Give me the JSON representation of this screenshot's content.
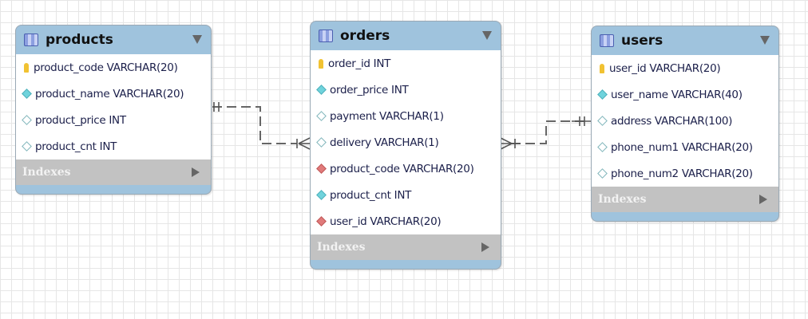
{
  "tables": [
    {
      "id": "products",
      "name": "products",
      "indexes_label": "Indexes",
      "columns": [
        {
          "text": "product_code VARCHAR(20)",
          "kind": "pk"
        },
        {
          "text": "product_name VARCHAR(20)",
          "kind": "nn"
        },
        {
          "text": "product_price INT",
          "kind": "null"
        },
        {
          "text": "product_cnt INT",
          "kind": "null"
        }
      ]
    },
    {
      "id": "orders",
      "name": "orders",
      "indexes_label": "Indexes",
      "columns": [
        {
          "text": "order_id INT",
          "kind": "pk"
        },
        {
          "text": "order_price INT",
          "kind": "nn"
        },
        {
          "text": "payment VARCHAR(1)",
          "kind": "null"
        },
        {
          "text": "delivery VARCHAR(1)",
          "kind": "null"
        },
        {
          "text": "product_code VARCHAR(20)",
          "kind": "fk"
        },
        {
          "text": "product_cnt INT",
          "kind": "nn"
        },
        {
          "text": "user_id VARCHAR(20)",
          "kind": "fk"
        }
      ]
    },
    {
      "id": "users",
      "name": "users",
      "indexes_label": "Indexes",
      "columns": [
        {
          "text": "user_id VARCHAR(20)",
          "kind": "pk"
        },
        {
          "text": "user_name VARCHAR(40)",
          "kind": "nn"
        },
        {
          "text": "address VARCHAR(100)",
          "kind": "null"
        },
        {
          "text": "phone_num1 VARCHAR(20)",
          "kind": "null"
        },
        {
          "text": "phone_num2 VARCHAR(20)",
          "kind": "null"
        }
      ]
    }
  ],
  "relationships": [
    {
      "from": "products",
      "to": "orders",
      "type": "one-to-many"
    },
    {
      "from": "users",
      "to": "orders",
      "type": "one-to-many"
    }
  ]
}
